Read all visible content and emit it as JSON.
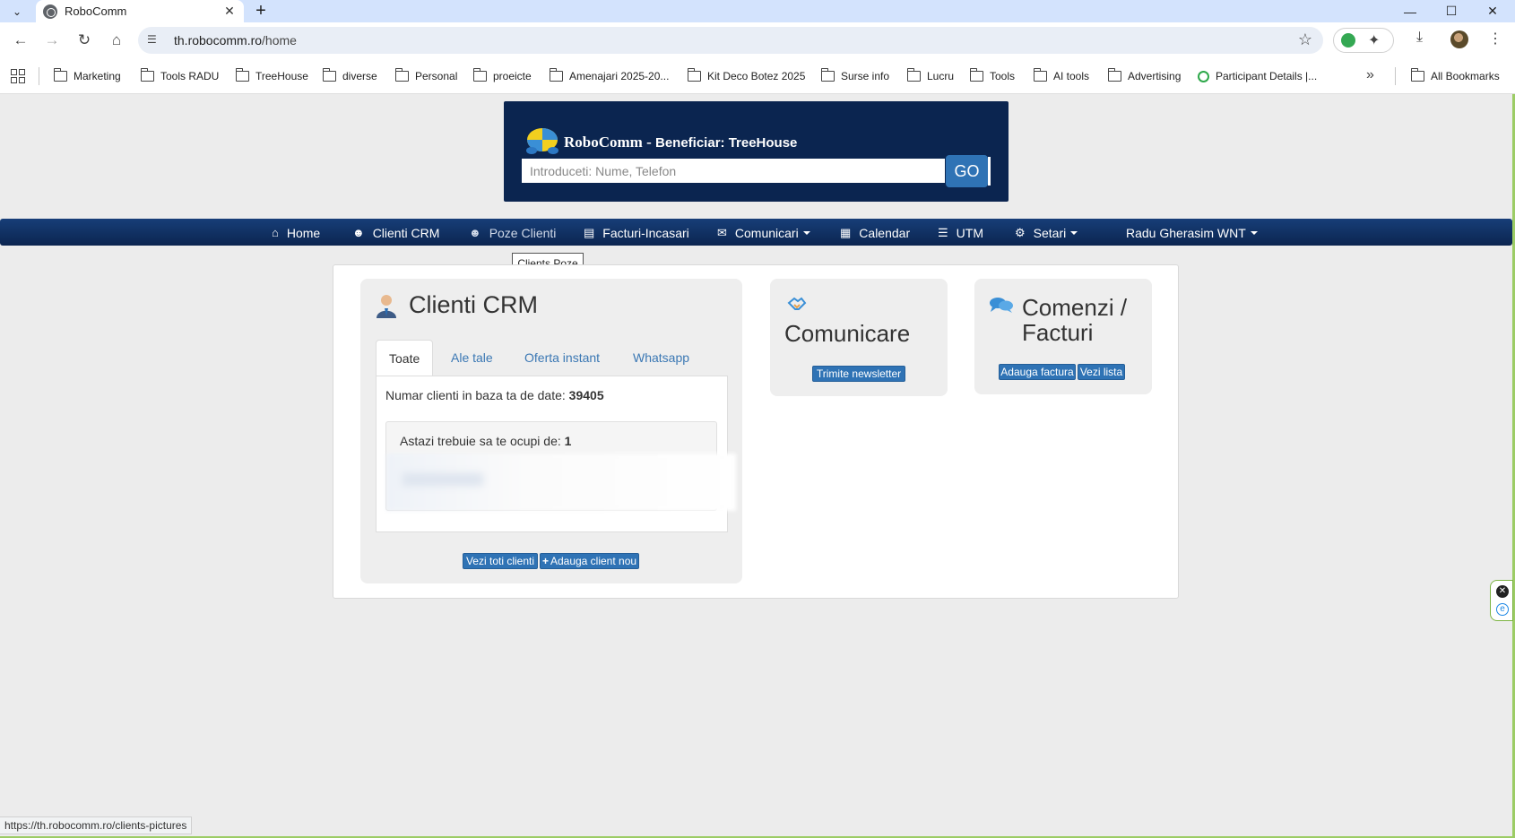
{
  "browser": {
    "tab_title": "RoboComm",
    "url_host": "th.robocomm.ro",
    "url_path": "/home",
    "bookmarks": [
      "Marketing",
      "Tools RADU",
      "TreeHouse",
      "diverse",
      "Personal",
      "proeicte",
      "Amenajari 2025-20...",
      "Kit Deco Botez 2025",
      "Surse info",
      "Lucru",
      "Tools",
      "AI tools",
      "Advertising",
      "Participant Details |...",
      "All Bookmarks"
    ],
    "status_url": "https://th.robocomm.ro/clients-pictures"
  },
  "header": {
    "brand": "RoboComm - ",
    "beneficiary": "Beneficiar: TreeHouse",
    "search_placeholder": "Introduceti: Nume, Telefon",
    "go_label": "GO"
  },
  "nav": {
    "home": "Home",
    "clienti_crm": "Clienti CRM",
    "poze_clienti": "Poze Clienti",
    "facturi": "Facturi-Incasari",
    "comunicari": "Comunicari",
    "calendar": "Calendar",
    "utm": "UTM",
    "setari": "Setari",
    "user": "Radu Gherasim WNT"
  },
  "tooltip": "Clients Poze",
  "crm": {
    "title": "Clienti CRM",
    "tabs": [
      "Toate",
      "Ale tale",
      "Oferta instant",
      "Whatsapp"
    ],
    "count_label": "Numar clienti in baza ta de date: ",
    "count_value": "39405",
    "today_label": "Astazi trebuie sa te ocupi de: ",
    "today_value": "1",
    "btn_all": "Vezi toti clienti",
    "btn_add": "Adauga client nou"
  },
  "comunicare": {
    "title": "Comunicare",
    "btn_newsletter": "Trimite newsletter"
  },
  "facturi": {
    "title_line1": "Comenzi /",
    "title_line2": "Facturi",
    "btn_add": "Adauga factura",
    "btn_list": "Vezi lista"
  }
}
